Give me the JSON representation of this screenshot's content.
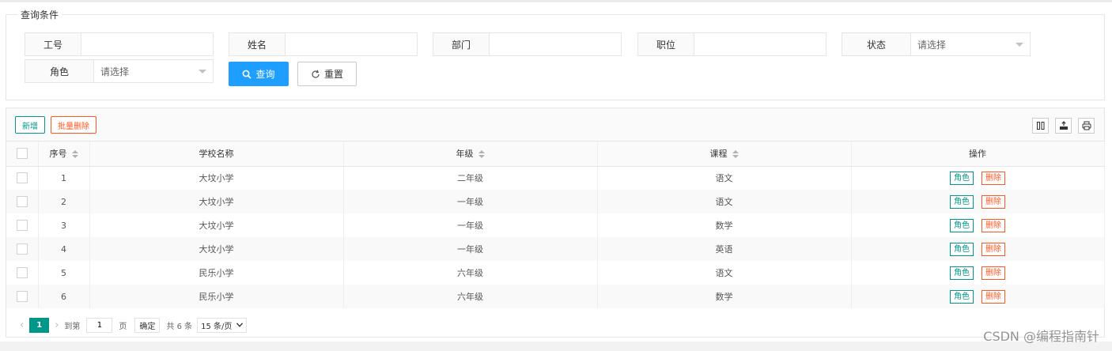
{
  "query": {
    "legend": "查询条件",
    "fields": [
      {
        "label": "工号",
        "value": "",
        "placeholder": ""
      },
      {
        "label": "姓名",
        "value": "",
        "placeholder": ""
      },
      {
        "label": "部门",
        "value": "",
        "placeholder": ""
      },
      {
        "label": "职位",
        "value": "",
        "placeholder": ""
      }
    ],
    "status": {
      "label": "状态",
      "selected": "请选择"
    },
    "role": {
      "label": "角色",
      "selected": "请选择"
    },
    "search_button": "查询",
    "reset_button": "重置"
  },
  "toolbar": {
    "add_label": "新增",
    "batch_delete_label": "批量删除",
    "tool_icons": [
      "columns-filter-icon",
      "export-icon",
      "print-icon"
    ]
  },
  "table": {
    "headers": {
      "index": "序号",
      "school": "学校名称",
      "grade": "年级",
      "course": "课程",
      "actions": "操作"
    },
    "action_labels": {
      "role": "角色",
      "delete": "删除"
    },
    "rows": [
      {
        "index": "1",
        "school": "大坟小学",
        "grade": "二年级",
        "course": "语文"
      },
      {
        "index": "2",
        "school": "大坟小学",
        "grade": "一年级",
        "course": "语文"
      },
      {
        "index": "3",
        "school": "大坟小学",
        "grade": "一年级",
        "course": "数学"
      },
      {
        "index": "4",
        "school": "大坟小学",
        "grade": "一年级",
        "course": "英语"
      },
      {
        "index": "5",
        "school": "民乐小学",
        "grade": "六年级",
        "course": "语文"
      },
      {
        "index": "6",
        "school": "民乐小学",
        "grade": "六年级",
        "course": "数学"
      }
    ]
  },
  "pagination": {
    "current_page": "1",
    "goto_label": "到第",
    "goto_value": "1",
    "page_unit": "页",
    "confirm": "确定",
    "total": "共 6 条",
    "page_size": "15 条/页"
  },
  "watermark": "CSDN @编程指南针",
  "colors": {
    "primary": "#1e9fff",
    "teal": "#009688",
    "danger": "#ff5722"
  }
}
